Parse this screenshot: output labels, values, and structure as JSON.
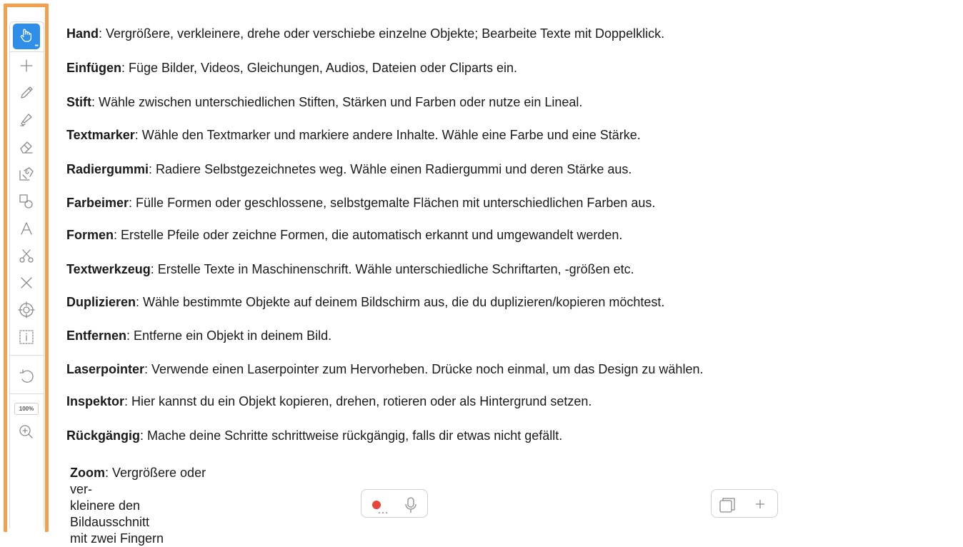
{
  "toolbar": {
    "zoom_level": "100%",
    "tools": [
      {
        "icon": "hand-icon",
        "active": true
      },
      {
        "icon": "plus-icon"
      },
      {
        "icon": "pen-icon"
      },
      {
        "icon": "highlighter-icon"
      },
      {
        "icon": "eraser-icon"
      },
      {
        "icon": "paint-bucket-icon"
      },
      {
        "icon": "shapes-icon"
      },
      {
        "icon": "text-tool-icon"
      },
      {
        "icon": "scissors-icon"
      },
      {
        "icon": "close-icon"
      },
      {
        "icon": "laser-pointer-icon"
      },
      {
        "icon": "inspector-icon"
      },
      {
        "icon": "undo-icon"
      },
      {
        "icon": "zoom-in-icon"
      }
    ],
    "accent_color": "#2f8fe8",
    "frame_color": "#f2a04e"
  },
  "descriptions": [
    {
      "term": "Hand",
      "text": ": Vergrößere, verkleinere, drehe oder verschiebe einzelne Objekte; Bearbeite Texte mit Doppelklick."
    },
    {
      "term": "Einfügen",
      "text": ": Füge Bilder, Videos, Gleichungen, Audios, Dateien oder Cliparts ein."
    },
    {
      "term": "Stift",
      "text": ": Wähle zwischen unterschiedlichen Stiften, Stärken und Farben oder nutze ein Lineal."
    },
    {
      "term": "Textmarker",
      "text": ": Wähle den Textmarker und markiere andere Inhalte. Wähle eine Farbe und eine Stärke."
    },
    {
      "term": "Radiergummi",
      "text": ": Radiere Selbstgezeichnetes weg. Wähle einen Radiergummi und deren Stärke aus."
    },
    {
      "term": "Farbeimer",
      "text": ": Fülle Formen oder geschlossene, selbstgemalte Flächen mit unterschiedlichen Farben aus."
    },
    {
      "term": "Formen",
      "text": ": Erstelle Pfeile oder zeichne Formen, die automatisch erkannt und umgewandelt werden."
    },
    {
      "term": "Textwerkzeug",
      "text": ": Erstelle Texte in Maschinenschrift. Wähle unterschiedliche Schriftarten, -größen etc."
    },
    {
      "term": "Duplizieren",
      "text": ": Wähle bestimmte Objekte auf deinem Bildschirm aus, die du duplizieren/kopieren möchtest."
    },
    {
      "term": "Entfernen",
      "text": ": Entferne ein Objekt in deinem Bild."
    },
    {
      "term": "Laserpointer",
      "text": ": Verwende einen Laserpointer zum Hervorheben. Drücke noch einmal, um das Design zu wählen."
    },
    {
      "term": "Inspektor",
      "text": ": Hier kannst du ein Objekt kopieren, drehen, rotieren oder als Hintergrund setzen."
    },
    {
      "term": "Rückgängig",
      "text": ": Mache deine Schritte schrittweise rückgängig, falls dir etwas nicht gefällt."
    }
  ],
  "zoom_description": {
    "term": "Zoom",
    "line1": ": Vergrößere oder ver-",
    "line2": "kleinere den Bildausschnitt",
    "line3": "mit zwei Fingern"
  },
  "record_controls": {
    "icons": [
      "record-icon",
      "microphone-icon"
    ],
    "record_color": "#e8453c"
  },
  "page_controls": {
    "icons": [
      "pages-icon",
      "add-page-icon"
    ]
  }
}
